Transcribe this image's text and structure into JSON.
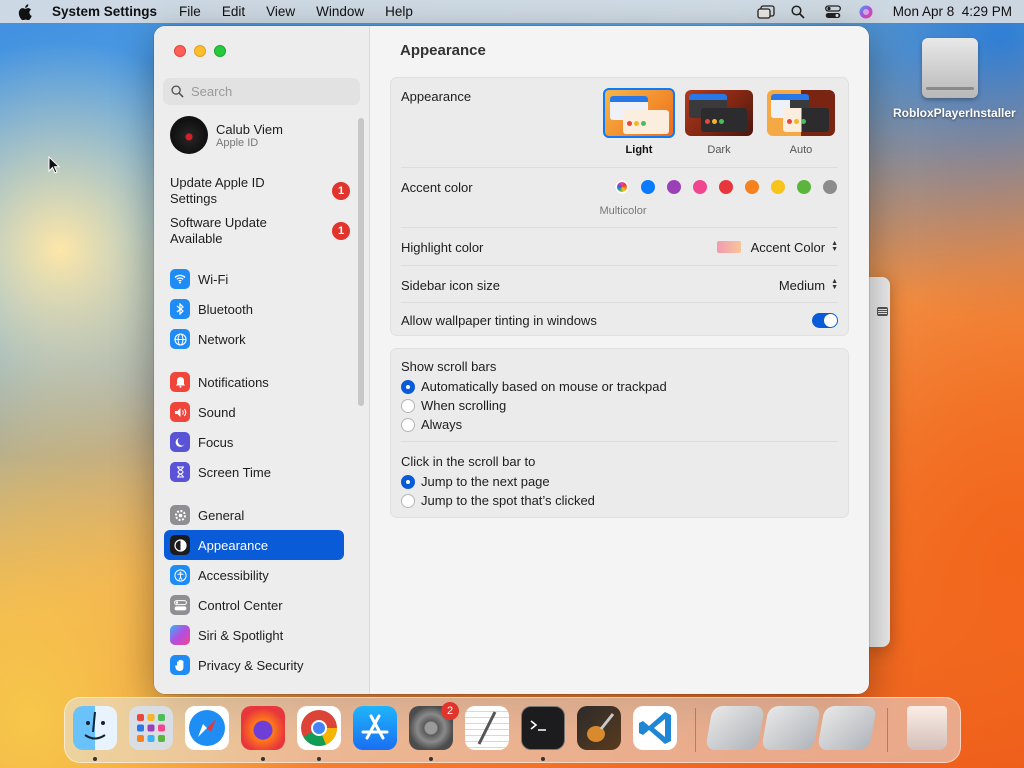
{
  "menubar": {
    "app_name": "System Settings",
    "menus": [
      "File",
      "Edit",
      "View",
      "Window",
      "Help"
    ],
    "datetime": "Mon Apr 8  4:29 PM"
  },
  "desktop": {
    "icon_label": "RobloxPlayerInstaller"
  },
  "sidebar": {
    "search_placeholder": "Search",
    "profile": {
      "name": "Calub Viem",
      "subtitle": "Apple ID"
    },
    "notices": [
      {
        "label": "Update Apple ID Settings",
        "badge": "1"
      },
      {
        "label": "Software Update Available",
        "badge": "1"
      }
    ],
    "items": [
      {
        "label": "Wi-Fi",
        "icon": "wifi-icon",
        "color": "#1f8cf6"
      },
      {
        "label": "Bluetooth",
        "icon": "bluetooth-icon",
        "color": "#1f8cf6"
      },
      {
        "label": "Network",
        "icon": "globe-icon",
        "color": "#1f8cf6"
      },
      {
        "label": "Notifications",
        "icon": "bell-icon",
        "color": "#f0453a"
      },
      {
        "label": "Sound",
        "icon": "speaker-icon",
        "color": "#f0453a"
      },
      {
        "label": "Focus",
        "icon": "moon-icon",
        "color": "#5a53d6"
      },
      {
        "label": "Screen Time",
        "icon": "hourglass-icon",
        "color": "#5a53d6"
      },
      {
        "label": "General",
        "icon": "gear-icon",
        "color": "#8e8e93"
      },
      {
        "label": "Appearance",
        "icon": "appearance-icon",
        "color": "#1c1c1e"
      },
      {
        "label": "Accessibility",
        "icon": "accessibility-icon",
        "color": "#1f8cf6"
      },
      {
        "label": "Control Center",
        "icon": "control-center-icon",
        "color": "#8e8e93"
      },
      {
        "label": "Siri & Spotlight",
        "icon": "siri-icon",
        "color": "#c03fb0"
      },
      {
        "label": "Privacy & Security",
        "icon": "hand-icon",
        "color": "#1f8cf6"
      }
    ],
    "selected": "Appearance"
  },
  "main": {
    "title": "Appearance",
    "appearance": {
      "label": "Appearance",
      "options": [
        "Light",
        "Dark",
        "Auto"
      ],
      "selected": "Light"
    },
    "accent": {
      "label": "Accent color",
      "colors": [
        "multicolor",
        "#0a7aff",
        "#9a41b8",
        "#f0468f",
        "#e8373c",
        "#f5821f",
        "#f8c31b",
        "#5bb53d",
        "#8c8c8c"
      ],
      "selected_caption": "Multicolor"
    },
    "highlight": {
      "label": "Highlight color",
      "value": "Accent Color"
    },
    "sidebar_icon_size": {
      "label": "Sidebar icon size",
      "value": "Medium"
    },
    "wallpaper_tinting": {
      "label": "Allow wallpaper tinting in windows",
      "enabled": true
    },
    "scroll_bars": {
      "label": "Show scroll bars",
      "options": [
        "Automatically based on mouse or trackpad",
        "When scrolling",
        "Always"
      ],
      "selected": 0
    },
    "click_scroll": {
      "label": "Click in the scroll bar to",
      "options": [
        "Jump to the next page",
        "Jump to the spot that’s clicked"
      ],
      "selected": 0
    },
    "help": "?"
  },
  "dock": {
    "apps": [
      "Finder",
      "Launchpad",
      "Safari",
      "Firefox",
      "Chrome",
      "App Store",
      "System Settings",
      "TextEdit",
      "Terminal",
      "GarageBand",
      "Visual Studio Code"
    ],
    "settings_badge": "2"
  }
}
